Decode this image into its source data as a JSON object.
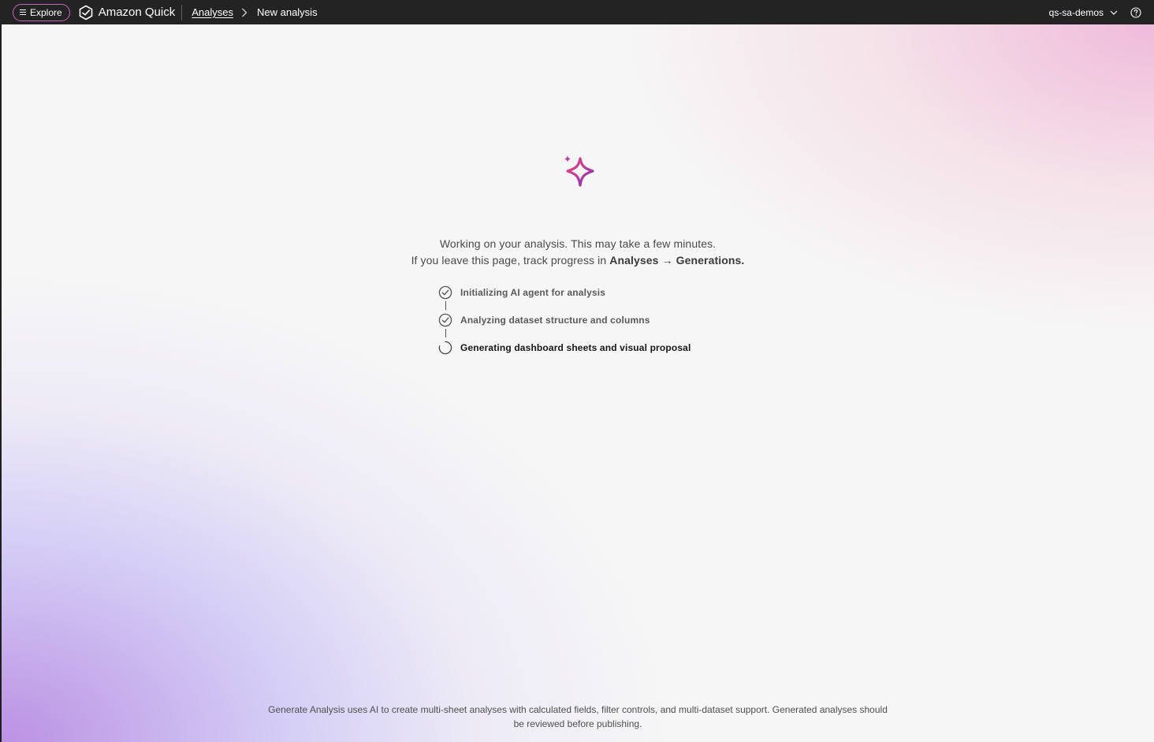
{
  "topbar": {
    "explore_label": "Explore",
    "brand_name": "Amazon Quick",
    "breadcrumb": {
      "parent": "Analyses",
      "current": "New analysis"
    },
    "account_name": "qs-sa-demos"
  },
  "status": {
    "line1": "Working on your analysis. This may take a few minutes.",
    "line2_prefix": "If you leave this page, track progress in",
    "line2_location": "Analyses",
    "line2_arrow": "→",
    "line2_target": "Generations."
  },
  "steps": [
    {
      "label": "Initializing AI agent for analysis",
      "state": "complete"
    },
    {
      "label": "Analyzing dataset structure and columns",
      "state": "complete"
    },
    {
      "label": "Generating dashboard sheets and visual proposal",
      "state": "in-progress"
    }
  ],
  "footer": {
    "note": "Generate Analysis uses AI to create multi-sheet analyses with calculated fields, filter controls, and multi-dataset support. Generated analyses should be reviewed before publishing."
  },
  "colors": {
    "topbar_bg": "#232323",
    "explore_border": "#c865b9",
    "sparkle_start": "#e8457a",
    "sparkle_end": "#7b2fbe"
  },
  "icons": {
    "menu": "hamburger-icon",
    "brand": "quick-logo-icon",
    "separator": "chevron-right-icon",
    "account": "chevron-down-icon",
    "help": "help-circle-icon",
    "hero": "sparkle-icon",
    "step_complete": "check-circle-icon",
    "step_progress": "spinner-icon"
  }
}
